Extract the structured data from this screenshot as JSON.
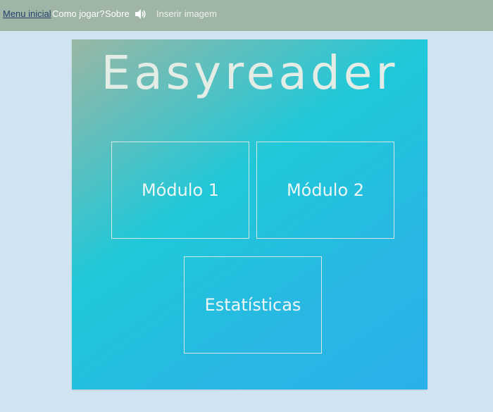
{
  "nav": {
    "menu_inicial": "Menu inicial",
    "como_jogar": "Como jogar?",
    "sobre": "Sobre",
    "sound_icon": "speaker-icon",
    "inserir_imagem": "Inserir imagem"
  },
  "main": {
    "title": "Easyreader",
    "buttons": [
      {
        "label": "Módulo 1"
      },
      {
        "label": "Módulo 2"
      },
      {
        "label": "Estatísticas"
      }
    ]
  },
  "colors": {
    "page_background": "#d0e5f1",
    "topbar_background": "#9fb5a6",
    "panel_gradient_start": "#9ab7a4",
    "panel_gradient_mid": "#1fc8d9",
    "panel_gradient_end": "#2ab0ea",
    "active_link": "#243f6b"
  }
}
